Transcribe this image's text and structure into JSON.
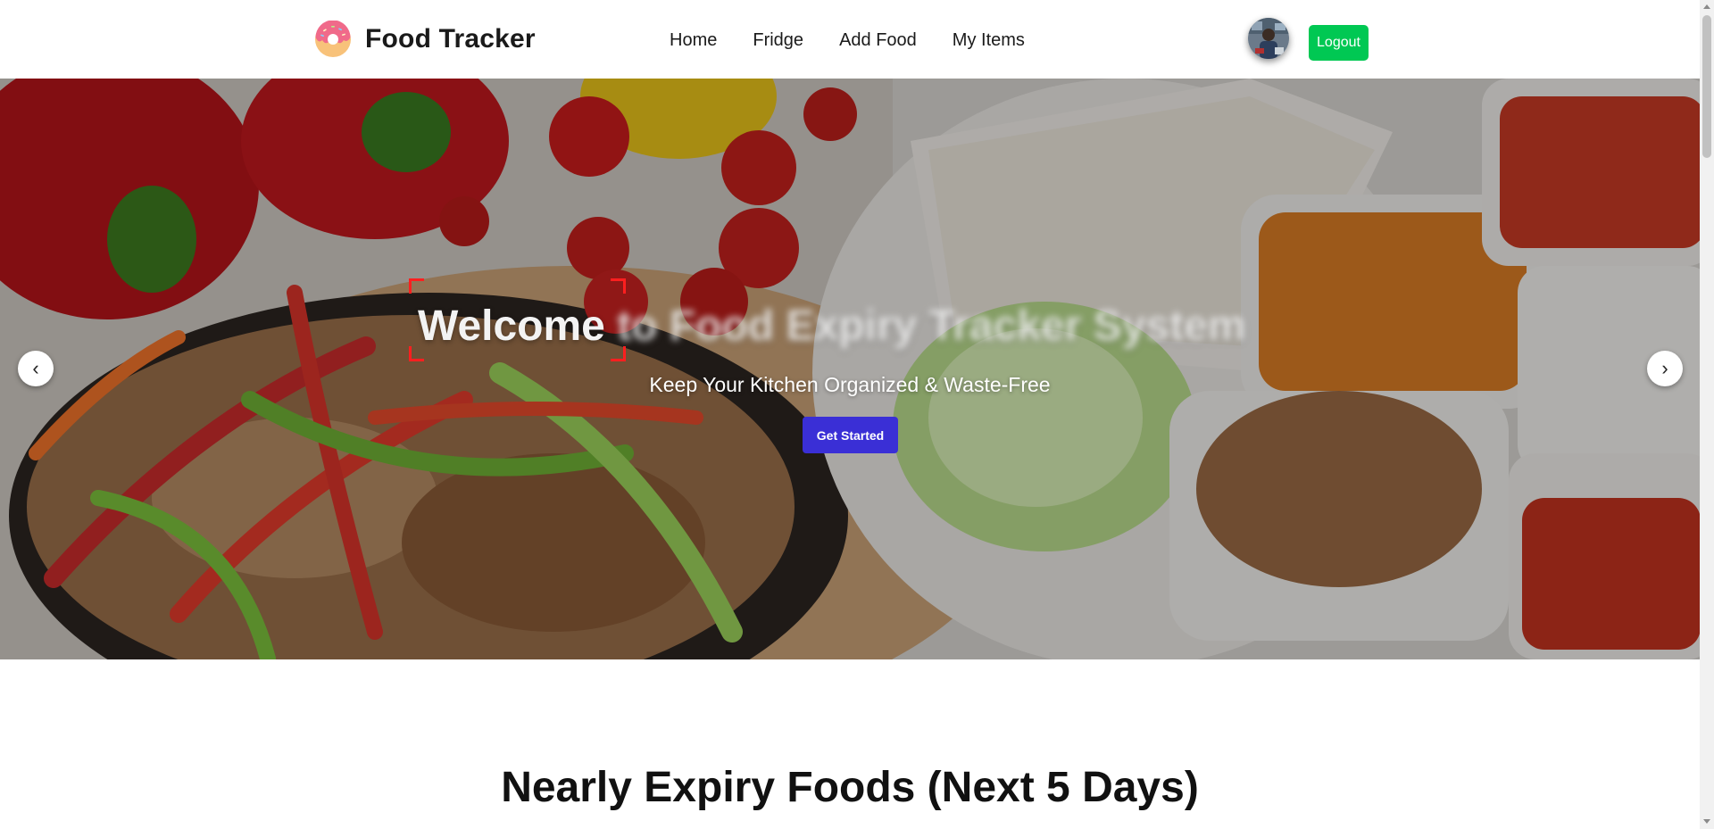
{
  "brand": {
    "name": "Food Tracker",
    "logo_icon": "donut-icon"
  },
  "nav": {
    "items": [
      {
        "label": "Home"
      },
      {
        "label": "Fridge"
      },
      {
        "label": "Add Food"
      },
      {
        "label": "My Items"
      }
    ]
  },
  "user": {
    "avatar_icon": "user-avatar",
    "logout_label": "Logout"
  },
  "hero": {
    "title_visible": "Welcome",
    "title_blurred": " to Food Expiry Tracker System",
    "subtitle": "Keep Your Kitchen Organized & Waste-Free",
    "cta_label": "Get Started",
    "prev_arrow": "‹",
    "next_arrow": "›"
  },
  "section": {
    "title": "Nearly Expiry Foods (Next 5 Days)"
  },
  "colors": {
    "logout_bg": "#00c853",
    "cta_bg": "#3a2fd6",
    "bracket": "#ff1f1f"
  }
}
